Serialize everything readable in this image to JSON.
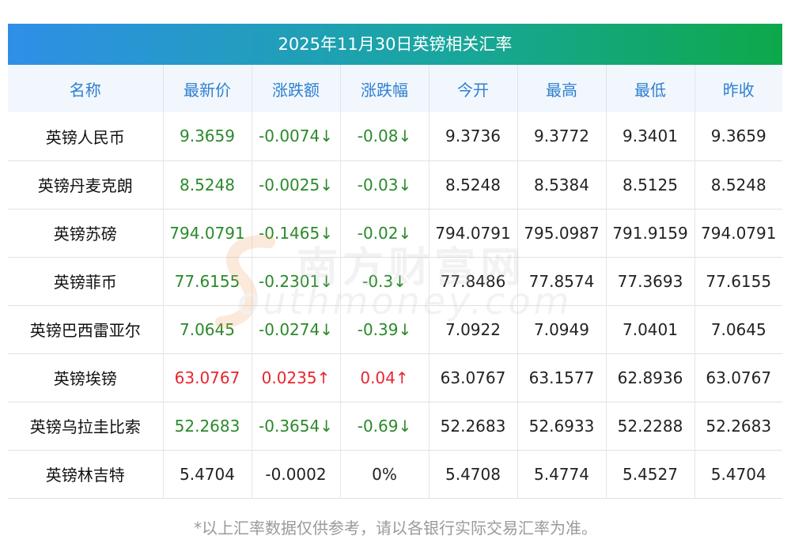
{
  "title": "2025年11月30日英镑相关汇率",
  "columns": [
    "名称",
    "最新价",
    "涨跌额",
    "涨跌幅",
    "今开",
    "最高",
    "最低",
    "昨收"
  ],
  "rows": [
    {
      "name": "英镑人民币",
      "latest": "9.3659",
      "change": "-0.0074↓",
      "change_pct": "-0.08↓",
      "open": "9.3736",
      "high": "9.3772",
      "low": "9.3401",
      "prev_close": "9.3659",
      "trend": "down"
    },
    {
      "name": "英镑丹麦克朗",
      "latest": "8.5248",
      "change": "-0.0025↓",
      "change_pct": "-0.03↓",
      "open": "8.5248",
      "high": "8.5384",
      "low": "8.5125",
      "prev_close": "8.5248",
      "trend": "down"
    },
    {
      "name": "英镑苏磅",
      "latest": "794.0791",
      "change": "-0.1465↓",
      "change_pct": "-0.02↓",
      "open": "794.0791",
      "high": "795.0987",
      "low": "791.9159",
      "prev_close": "794.0791",
      "trend": "down"
    },
    {
      "name": "英镑菲币",
      "latest": "77.6155",
      "change": "-0.2301↓",
      "change_pct": "-0.3↓",
      "open": "77.8486",
      "high": "77.8574",
      "low": "77.3693",
      "prev_close": "77.6155",
      "trend": "down"
    },
    {
      "name": "英镑巴西雷亚尔",
      "latest": "7.0645",
      "change": "-0.0274↓",
      "change_pct": "-0.39↓",
      "open": "7.0922",
      "high": "7.0949",
      "low": "7.0401",
      "prev_close": "7.0645",
      "trend": "down"
    },
    {
      "name": "英镑埃镑",
      "latest": "63.0767",
      "change": "0.0235↑",
      "change_pct": "0.04↑",
      "open": "63.0767",
      "high": "63.1577",
      "low": "62.8936",
      "prev_close": "63.0767",
      "trend": "up"
    },
    {
      "name": "英镑乌拉圭比索",
      "latest": "52.2683",
      "change": "-0.3654↓",
      "change_pct": "-0.69↓",
      "open": "52.2683",
      "high": "52.6933",
      "low": "52.2288",
      "prev_close": "52.2683",
      "trend": "down"
    },
    {
      "name": "英镑林吉特",
      "latest": "5.4704",
      "change": "-0.0002",
      "change_pct": "0%",
      "open": "5.4708",
      "high": "5.4774",
      "low": "5.4527",
      "prev_close": "5.4704",
      "trend": "flat"
    }
  ],
  "note": "*以上汇率数据仅供参考，请以各银行实际交易汇率为准。",
  "watermark": {
    "cn": "南方财富网",
    "en": "outhmoney.com"
  },
  "colors": {
    "down": "#2a8a2a",
    "up": "#e8262d",
    "header_text": "#2f7fd0",
    "gradient_start": "#2f8fe8",
    "gradient_end": "#0ea84a"
  }
}
